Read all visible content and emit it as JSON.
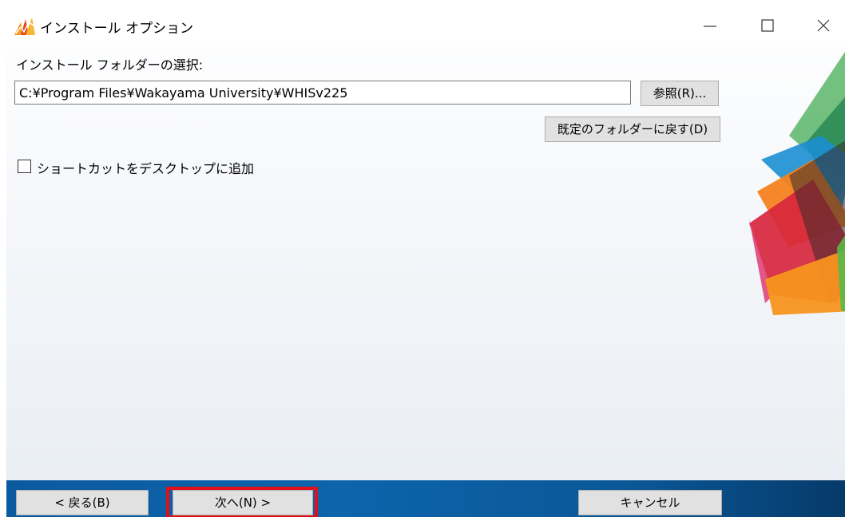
{
  "window": {
    "title": "インストール オプション"
  },
  "form": {
    "folder_label": "インストール フォルダーの選択:",
    "folder_path": "C:¥Program Files¥Wakayama University¥WHISv225",
    "browse_button": "参照(R)...",
    "default_folder_button": "既定のフォルダーに戻す(D)",
    "shortcut_checkbox_label": "ショートカットをデスクトップに追加",
    "shortcut_checked": false
  },
  "footer": {
    "back_button": "< 戻る(B)",
    "next_button": "次へ(N) >",
    "cancel_button": "キャンセル"
  },
  "colors": {
    "footer_blue": "#0b5aa0",
    "highlight_red": "#e0101a",
    "button_gray": "#e1e1e1"
  },
  "icons": {
    "app": "wakayama-app-icon",
    "minimize": "minimize-icon",
    "maximize": "maximize-icon",
    "close": "close-icon"
  }
}
